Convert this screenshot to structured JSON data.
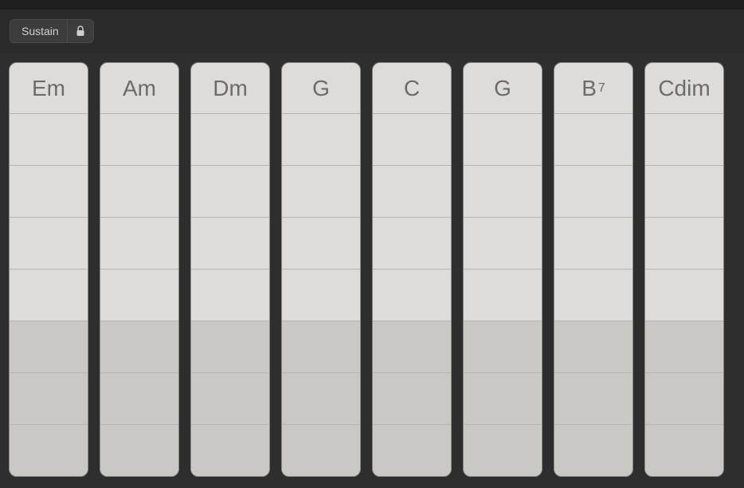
{
  "toolbar": {
    "sustain_label": "Sustain"
  },
  "chords": [
    {
      "root": "Em",
      "ext": ""
    },
    {
      "root": "Am",
      "ext": ""
    },
    {
      "root": "Dm",
      "ext": ""
    },
    {
      "root": "G",
      "ext": ""
    },
    {
      "root": "C",
      "ext": ""
    },
    {
      "root": "G",
      "ext": ""
    },
    {
      "root": "B",
      "ext": "7"
    },
    {
      "root": "Cdim",
      "ext": ""
    }
  ],
  "string_rows": {
    "upper": 4,
    "bass": 3
  }
}
